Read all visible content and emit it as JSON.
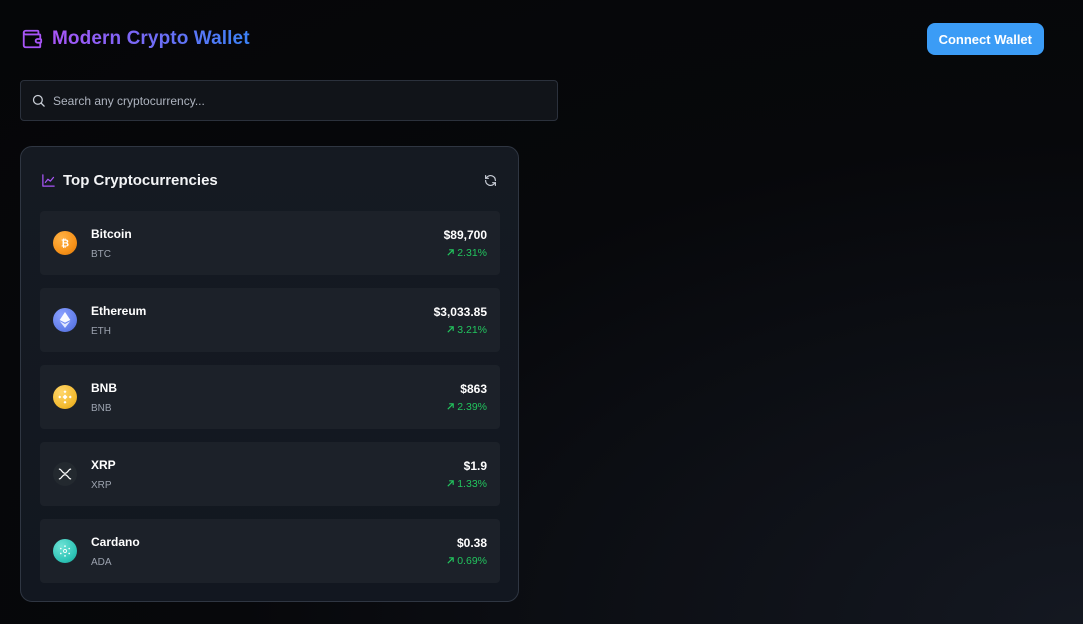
{
  "header": {
    "title": "Modern Crypto Wallet",
    "connect_label": "Connect Wallet"
  },
  "search": {
    "placeholder": "Search any cryptocurrency..."
  },
  "panel": {
    "title": "Top Cryptocurrencies"
  },
  "coins": [
    {
      "name": "Bitcoin",
      "symbol": "BTC",
      "price": "$89,700",
      "change": "2.31%",
      "icon": "bitcoin-icon",
      "color": "#f7931a"
    },
    {
      "name": "Ethereum",
      "symbol": "ETH",
      "price": "$3,033.85",
      "change": "3.21%",
      "icon": "ethereum-icon",
      "color": "#627eea"
    },
    {
      "name": "BNB",
      "symbol": "BNB",
      "price": "$863",
      "change": "2.39%",
      "icon": "bnb-icon",
      "color": "#f3ba2f"
    },
    {
      "name": "XRP",
      "symbol": "XRP",
      "price": "$1.9",
      "change": "1.33%",
      "icon": "xrp-icon",
      "color": "#23292f"
    },
    {
      "name": "Cardano",
      "symbol": "ADA",
      "price": "$0.38",
      "change": "0.69%",
      "icon": "cardano-icon",
      "color": "#2ec4b6"
    }
  ],
  "colors": {
    "accent_purple": "#a855f7",
    "accent_blue": "#3b82f6",
    "button_blue": "#3b9cf6",
    "positive_green": "#22c55e"
  }
}
